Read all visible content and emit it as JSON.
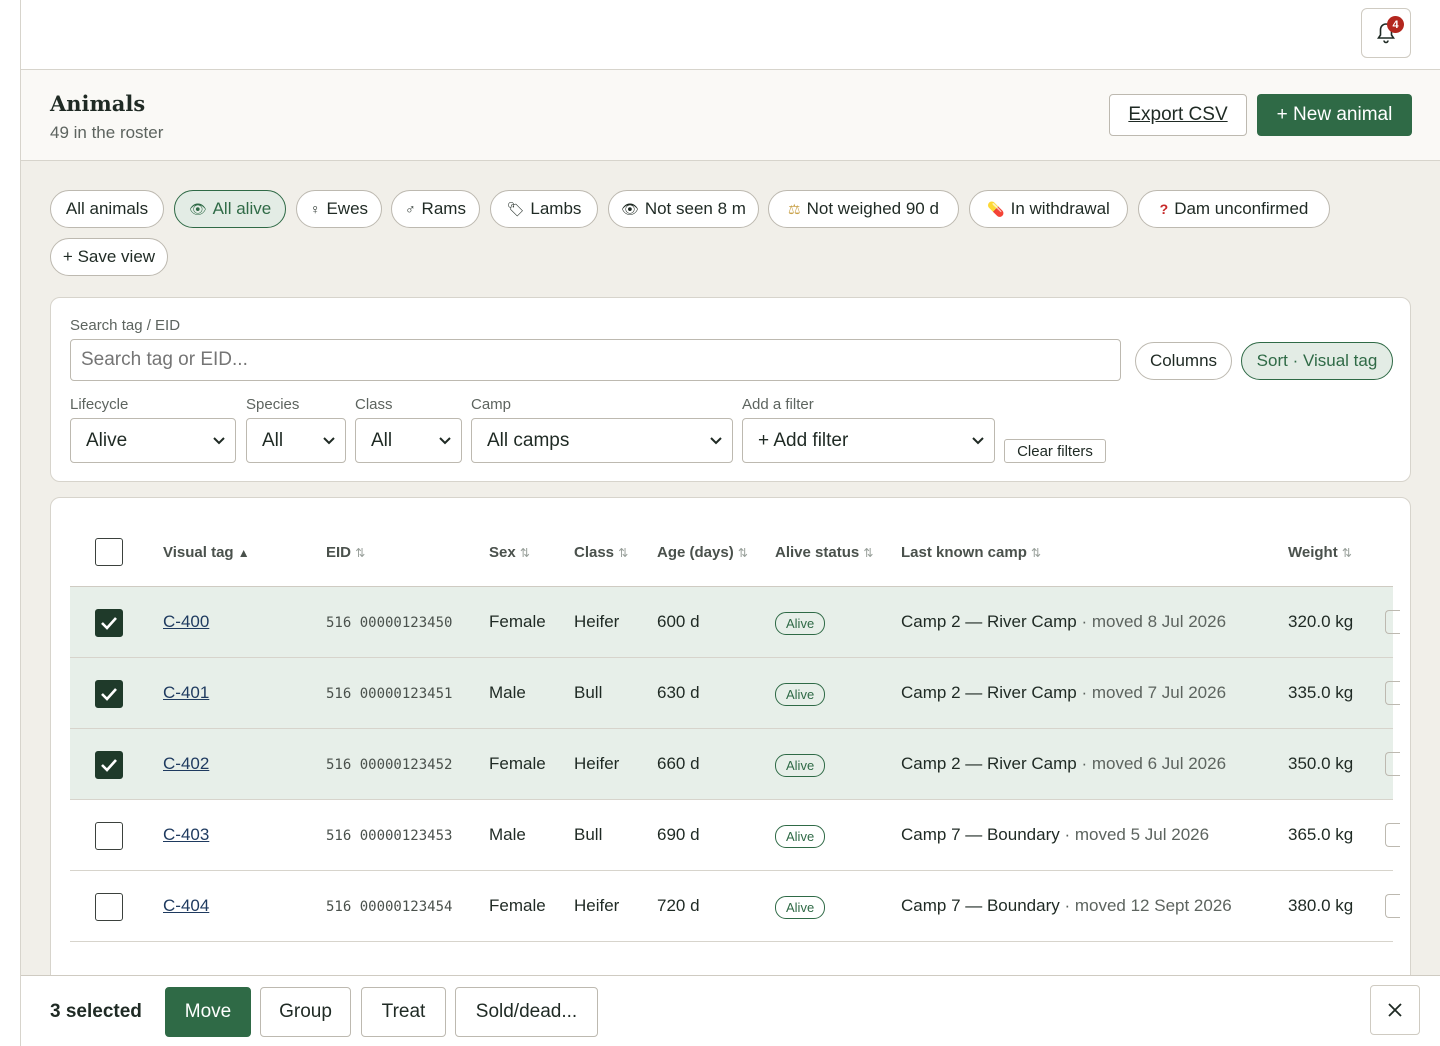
{
  "notifications": {
    "count": "4"
  },
  "header": {
    "title": "Animals",
    "subtitle": "49 in the roster",
    "export_label": "Export CSV",
    "new_label": "+ New animal"
  },
  "chips": [
    {
      "label": "All animals",
      "icon": ""
    },
    {
      "label": "All alive",
      "icon": "eye-icon",
      "glyph": "👁"
    },
    {
      "label": "Ewes",
      "icon": "female-icon",
      "glyph": "♀"
    },
    {
      "label": "Rams",
      "icon": "male-icon",
      "glyph": "♂"
    },
    {
      "label": "Lambs",
      "icon": "tag-icon",
      "glyph": "🏷"
    },
    {
      "label": "Not seen 8 m",
      "icon": "eye-icon",
      "glyph": "👁"
    },
    {
      "label": "Not weighed 90 d",
      "icon": "scale-icon",
      "glyph": "⚖"
    },
    {
      "label": "In withdrawal",
      "icon": "pill-icon",
      "glyph": "💊"
    },
    {
      "label": "Dam unconfirmed",
      "icon": "question-icon",
      "glyph": "?"
    }
  ],
  "save_view_label": "+ Save view",
  "filters": {
    "search_label": "Search tag / EID",
    "search_placeholder": "Search tag or EID...",
    "columns_label": "Columns",
    "sort_label": "Sort · Visual tag",
    "lifecycle_label": "Lifecycle",
    "lifecycle_value": "Alive",
    "species_label": "Species",
    "species_value": "All",
    "class_label": "Class",
    "class_value": "All",
    "camp_label": "Camp",
    "camp_value": "All camps",
    "add_filter_label": "Add a filter",
    "add_filter_value": "+ Add filter",
    "clear_label": "Clear filters"
  },
  "table": {
    "columns": [
      "Visual tag",
      "EID",
      "Sex",
      "Class",
      "Age (days)",
      "Alive status",
      "Last known camp",
      "Weight"
    ],
    "rows": [
      {
        "selected": true,
        "tag": "C-400",
        "eid": "516 00000123450",
        "sex": "Female",
        "class": "Heifer",
        "age": "600 d",
        "status": "Alive",
        "camp": "Camp 2 — River Camp",
        "moved": " · moved 8 Jul 2026",
        "weight": "320.0 kg"
      },
      {
        "selected": true,
        "tag": "C-401",
        "eid": "516 00000123451",
        "sex": "Male",
        "class": "Bull",
        "age": "630 d",
        "status": "Alive",
        "camp": "Camp 2 — River Camp",
        "moved": " · moved 7 Jul 2026",
        "weight": "335.0 kg"
      },
      {
        "selected": true,
        "tag": "C-402",
        "eid": "516 00000123452",
        "sex": "Female",
        "class": "Heifer",
        "age": "660 d",
        "status": "Alive",
        "camp": "Camp 2 — River Camp",
        "moved": " · moved 6 Jul 2026",
        "weight": "350.0 kg"
      },
      {
        "selected": false,
        "tag": "C-403",
        "eid": "516 00000123453",
        "sex": "Male",
        "class": "Bull",
        "age": "690 d",
        "status": "Alive",
        "camp": "Camp 7 — Boundary",
        "moved": " · moved 5 Jul 2026",
        "weight": "365.0 kg"
      },
      {
        "selected": false,
        "tag": "C-404",
        "eid": "516 00000123454",
        "sex": "Female",
        "class": "Heifer",
        "age": "720 d",
        "status": "Alive",
        "camp": "Camp 7 — Boundary",
        "moved": " · moved 12 Sept 2026",
        "weight": "380.0 kg"
      }
    ]
  },
  "bulk": {
    "selected_label": "3 selected",
    "move": "Move",
    "group": "Group",
    "treat": "Treat",
    "sold": "Sold/dead..."
  },
  "colors": {
    "accent": "#2f6a46",
    "background": "#f1efe9",
    "badge": "#b3261e",
    "link": "#1e3a5f"
  }
}
